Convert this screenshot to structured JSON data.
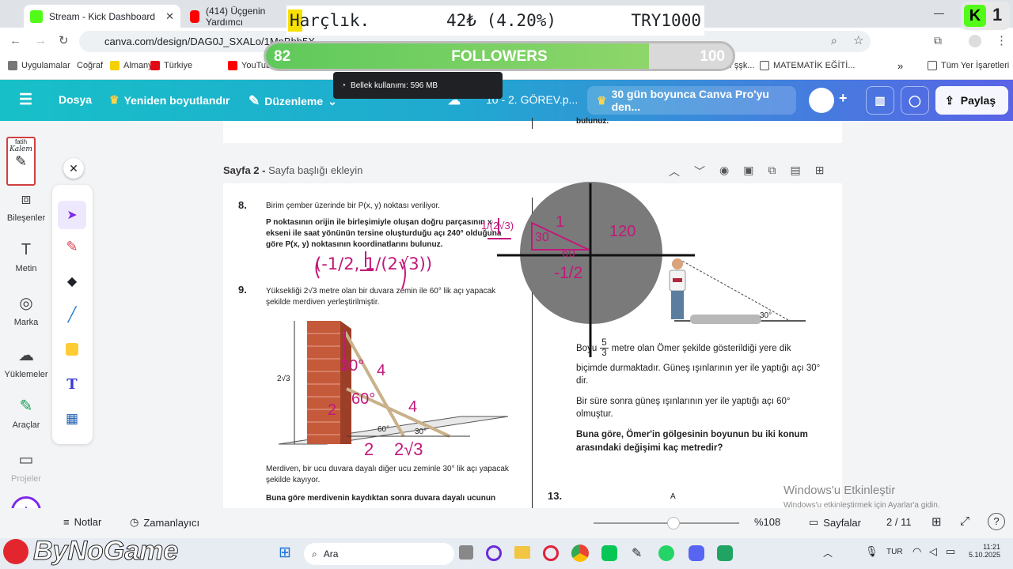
{
  "browser": {
    "tabs": [
      {
        "title": "Stream - Kick Dashboard",
        "active": true,
        "color": "#53fc18"
      },
      {
        "title": "(414) Üçgenin Yardımcı",
        "active": false,
        "color": "#ff0000"
      }
    ],
    "url": "canva.com/design/DAG0J_SXALo/1MnBbh5X...",
    "bookmarks": [
      "Uygulamalar",
      "Coğraf",
      "Almanya",
      "Türkiye",
      "YouTube",
      "Divan edebiyatı şşk...",
      "MATEMATİK EĞİTİ...",
      "Tüm Yer İşaretleri"
    ]
  },
  "canva": {
    "file_menu": "Dosya",
    "resize": "Yeniden boyutlandır",
    "edit": "Düzenleme",
    "doc_title": "10 - 2. GÖREV.p...",
    "promo": "30 gün boyunca Canva Pro'yu den...",
    "share": "Paylaş"
  },
  "rail": [
    "Bileşenler",
    "Metin",
    "Marka",
    "Yüklemeler",
    "Araçlar",
    "Projeler"
  ],
  "page1": {
    "fragment": "bulunuz."
  },
  "page2": {
    "label": "Sayfa 2 -",
    "title_placeholder": "Sayfa başlığı ekleyin",
    "q8": {
      "num": "8.",
      "line1": "Birim çember üzerinde bir P(x, y) noktası veriliyor.",
      "bold": "P noktasının orijin ile birleşimiyle oluşan doğru parçasının x ekseni ile saat yönünün tersine oluşturduğu açı 240° olduğuna göre P(x, y) noktasının koordinatlarını bulunuz."
    },
    "q9": {
      "num": "9.",
      "text": "Yüksekliği 2√3 metre olan bir duvara zemin ile 60° lik açı yapacak şekilde merdiven yerleştirilmiştir.",
      "height_label": "2√3",
      "angle60": "60°",
      "angle30": "30°",
      "after": "Merdiven, bir ucu duvara dayalı diğer ucu zeminle 30° lik açı yapacak şekilde kayıyor.",
      "bold": "Buna göre merdivenin kaydıktan sonra duvara dayalı ucunun"
    },
    "q_right": {
      "shadow_angle": "30°",
      "line1a": "Boyu",
      "frac_num": "5",
      "frac_den": "3",
      "line1b": "metre olan Ömer şekilde gösterildiği yere dik",
      "line2": "biçimde durmaktadır. Güneş ışınlarının yer ile yaptığı açı 30° dir.",
      "line3": "Bir süre sonra güneş ışınlarının yer ile yaptığı açı 60° olmuştur.",
      "bold": "Buna göre, Ömer'in gölgesinin boyunun bu iki konum arasındaki değişimi kaç metredir?"
    },
    "q13": {
      "num": "13.",
      "label": "A"
    }
  },
  "handwriting": {
    "q8_answer": "(-1/2, 1/(2√3))",
    "unit_frac": "1/(2√3)",
    "circle_labels": [
      "1",
      "30",
      "120",
      "60",
      "-1/2"
    ],
    "q9_notes": [
      "30°",
      "4",
      "60°",
      "2",
      "4",
      "2",
      "2√3"
    ]
  },
  "bottom": {
    "notes": "Notlar",
    "timer": "Zamanlayıcı",
    "zoom": "%108",
    "pages": "Sayfalar",
    "page_count": "2 / 11",
    "zoom_level": 0.55
  },
  "windows": {
    "watermark_title": "Windows'u Etkinleştir",
    "watermark_sub": "Windows'u etkinleştirmek için Ayarlar'a gidin.",
    "search": "Ara",
    "lang": "TUR",
    "time": "11:21",
    "date": "5.10.2025"
  },
  "overlays": {
    "harclik_label": "Harçlık.",
    "harclik_value": "42₺ (4.20%)",
    "harclik_goal": "TRY1000",
    "followers_current": "82",
    "followers_label": "FOLLOWERS",
    "followers_goal": "100",
    "followers_progress": 0.82,
    "memory": "Bellek kullanımı: 596 MB",
    "kick_count": "1",
    "brand": "ByNoGame",
    "pen_caption_top": "fatih",
    "pen_caption": "Kalem"
  },
  "colors": {
    "accent": "#7d2ae8",
    "ink": "#c2187a",
    "kick": "#53fc18"
  }
}
